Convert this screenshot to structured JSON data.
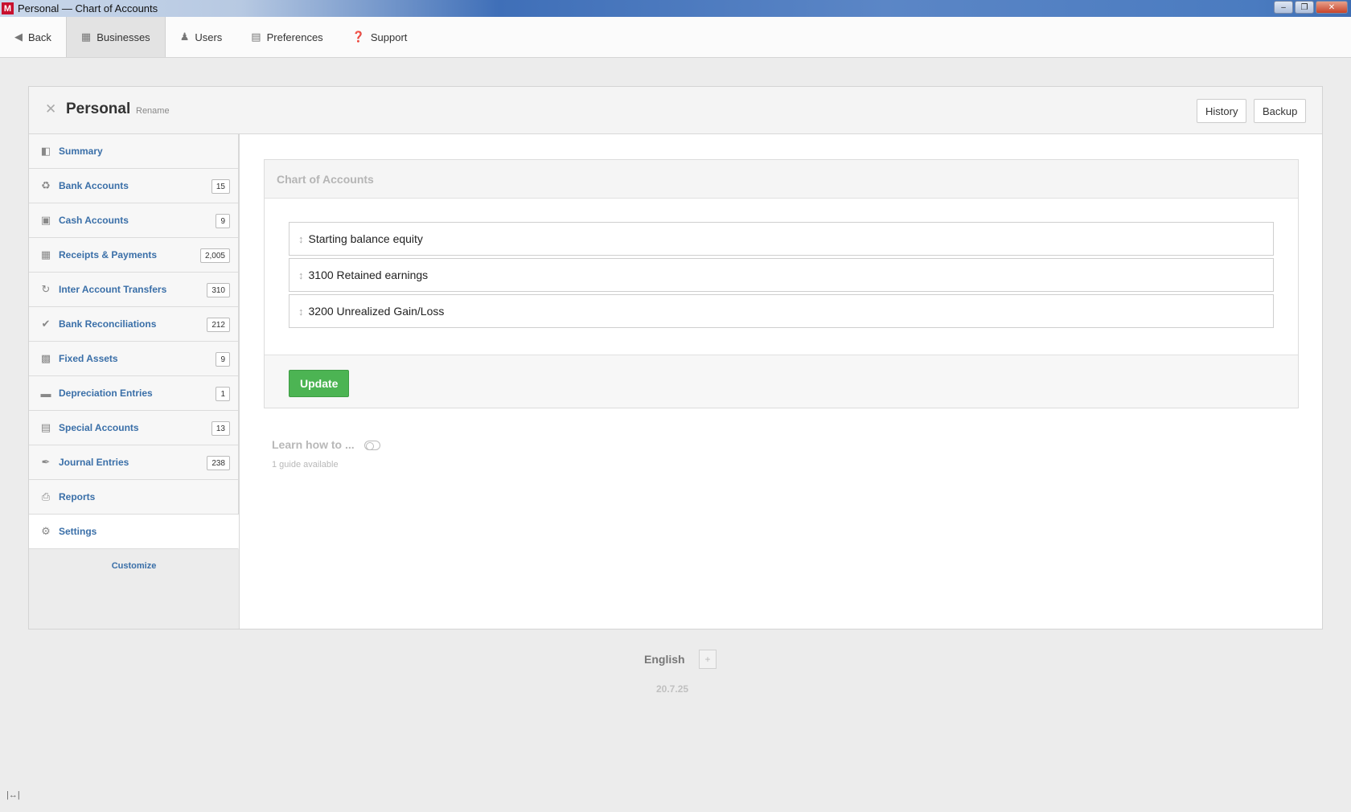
{
  "window": {
    "title": "Personal — Chart of Accounts",
    "app_icon": "M"
  },
  "topnav": {
    "back": "Back",
    "businesses": "Businesses",
    "users": "Users",
    "preferences": "Preferences",
    "support": "Support"
  },
  "business": {
    "name": "Personal",
    "rename": "Rename",
    "history": "History",
    "backup": "Backup"
  },
  "sidebar": {
    "items": [
      {
        "label": "Summary",
        "count": "",
        "icon": "presentation-icon"
      },
      {
        "label": "Bank Accounts",
        "count": "15",
        "icon": "bank-icon"
      },
      {
        "label": "Cash Accounts",
        "count": "9",
        "icon": "cash-register-icon"
      },
      {
        "label": "Receipts & Payments",
        "count": "2,005",
        "icon": "receipt-icon"
      },
      {
        "label": "Inter Account Transfers",
        "count": "310",
        "icon": "transfer-icon"
      },
      {
        "label": "Bank Reconciliations",
        "count": "212",
        "icon": "checkmark-icon"
      },
      {
        "label": "Fixed Assets",
        "count": "9",
        "icon": "building-icon"
      },
      {
        "label": "Depreciation Entries",
        "count": "1",
        "icon": "depreciation-icon"
      },
      {
        "label": "Special Accounts",
        "count": "13",
        "icon": "ledger-icon"
      },
      {
        "label": "Journal Entries",
        "count": "238",
        "icon": "quill-icon"
      },
      {
        "label": "Reports",
        "count": "",
        "icon": "printer-icon"
      },
      {
        "label": "Settings",
        "count": "",
        "icon": "gears-icon"
      }
    ],
    "customize": "Customize"
  },
  "main": {
    "panel_title": "Chart of Accounts",
    "accounts": [
      "Starting balance equity",
      "3100 Retained earnings",
      "3200 Unrealized Gain/Loss"
    ],
    "update": "Update",
    "learn": "Learn how to ...",
    "guides": "1 guide available"
  },
  "footer": {
    "language": "English",
    "add": "+",
    "version": "20.7.25"
  },
  "colors": {
    "link": "#3a6fa8",
    "update_button": "#4cb453"
  }
}
